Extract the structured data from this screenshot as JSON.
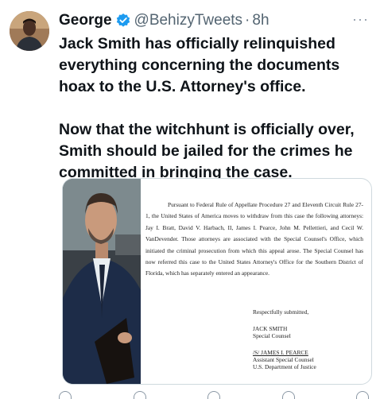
{
  "tweet": {
    "author_name": "George",
    "handle": "@BehizyTweets",
    "separator": "·",
    "time": "8h",
    "more": "···",
    "paragraphs": [
      "Jack Smith has officially relinquished everything concerning the documents hoax to the U.S. Attorney's office.",
      "Now that the witchhunt is officially over, Smith should be jailed for the crimes he committed in bringing the case."
    ]
  },
  "document": {
    "body": "Pursuant to Federal Rule of Appellate Procedure 27 and Eleventh Circuit Rule 27-1, the United States of America moves to withdraw from this case the following attorneys: Jay I. Bratt, David V. Harbach, II, James I. Pearce, John M. Pellettieri, and Cecil W. VanDevender.  Those attorneys are associated with the Special Counsel's Office, which initiated the criminal prosecution from which this appeal arose.  The Special Counsel has now referred this case to the United States Attorney's Office for the Southern District of Florida, which has separately entered an appearance.",
    "closing": "Respectfully submitted,",
    "signer1_name": "JACK SMITH",
    "signer1_title": "Special Counsel",
    "signer2_name": "/S/ JAMES I. PEARCE",
    "signer2_title": "Assistant Special Counsel",
    "signer2_dept": "U.S. Department of Justice"
  },
  "colors": {
    "text": "#0f1419",
    "secondary": "#536471",
    "verified": "#1d9bf0",
    "border": "#cfd9de"
  }
}
